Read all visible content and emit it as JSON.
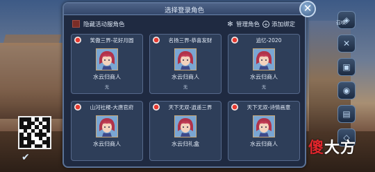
{
  "dialog": {
    "title": "选择登录角色",
    "hide_activity_label": "隐藏活动服角色",
    "manage_label": "管理角色",
    "add_bind_label": "添加绑定"
  },
  "characters": [
    {
      "server": "笑傲三界-花好月圆",
      "name": "水云归商人",
      "sub": "无"
    },
    {
      "server": "名扬三界-恭喜发财",
      "name": "水云归商人",
      "sub": "无"
    },
    {
      "server": "追忆-2020",
      "name": "水云归商人",
      "sub": "无"
    },
    {
      "server": "山河社稷-大唐官府",
      "name": "水云归商人",
      "sub": ""
    },
    {
      "server": "天下无双-逍遥三界",
      "name": "水云归礼盒",
      "sub": ""
    },
    {
      "server": "天下无双-诗情画意",
      "name": "水云归商人",
      "sub": ""
    }
  ],
  "side_menu": {
    "label_top": "召唤"
  },
  "watermark": {
    "part1": "傻",
    "part2": "大方"
  },
  "icons": {
    "close": "close-icon",
    "manage": "gear-icon",
    "add": "plus-circle-icon",
    "check": "check-icon"
  }
}
